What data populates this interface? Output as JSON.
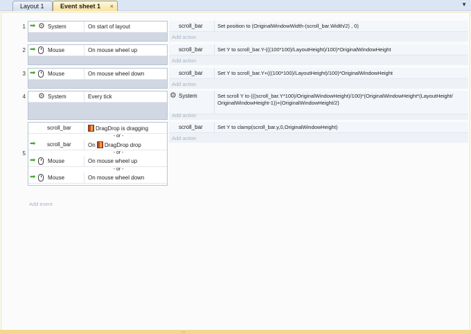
{
  "tabs": [
    {
      "label": "Layout 1"
    },
    {
      "label": "Event sheet 1",
      "close": "×",
      "active": true
    }
  ],
  "tab_menu_icon": "chevron-down-icon",
  "events": [
    {
      "number": "1",
      "conditions": [
        {
          "object": "System",
          "icon": "gear-icon",
          "text": "On start of layout"
        }
      ],
      "actions": [
        {
          "object": "scroll_bar",
          "text": "Set position to (OriginalWindowWidth-(scroll_bar.Width/2)  , 0)"
        }
      ],
      "add_action": "Add action"
    },
    {
      "number": "2",
      "conditions": [
        {
          "object": "Mouse",
          "icon": "mouse-icon",
          "text": "On mouse wheel up"
        }
      ],
      "actions": [
        {
          "object": "scroll_bar",
          "text": "Set Y to scroll_bar.Y-(((100*100)/LayoutHeight)/100)*OriginalWindowHeight"
        }
      ],
      "add_action": "Add action"
    },
    {
      "number": "3",
      "conditions": [
        {
          "object": "Mouse",
          "icon": "mouse-icon",
          "text": "On mouse wheel down"
        }
      ],
      "actions": [
        {
          "object": "scroll_bar",
          "text": "Set Y to scroll_bar.Y+(((100*100)/LayoutHeight)/100)*OriginalWindowHeight"
        }
      ],
      "add_action": "Add action"
    },
    {
      "number": "4",
      "conditions": [
        {
          "object": "System",
          "icon": "gear-icon",
          "text": "Every tick"
        }
      ],
      "actions": [
        {
          "object": "System",
          "icon": "gear-icon",
          "text_line1": "Set scroll Y to (((scroll_bar.Y*100)/OriginalWindowHeight)/100)*(OriginalWindowHeight*(LayoutHeight/",
          "text_line2": "OriginalWindowHeight-1))+(OriginalWindowHeight/2)"
        }
      ],
      "add_action": "Add action"
    },
    {
      "number": "5",
      "conditions": [
        {
          "object": "scroll_bar",
          "icon": "",
          "text": "DragDrop is dragging"
        },
        {
          "object": "scroll_bar",
          "icon": "",
          "text_prefix": "On",
          "text": "DragDrop drop"
        },
        {
          "object": "Mouse",
          "icon": "mouse-icon",
          "text": "On mouse wheel up"
        },
        {
          "object": "Mouse",
          "icon": "mouse-icon",
          "text": "On mouse wheel down"
        }
      ],
      "or_label": "- or -",
      "actions": [
        {
          "object": "scroll_bar",
          "text": "Set Y to clamp(scroll_bar.y,0,OriginalWindowHeight)"
        }
      ],
      "add_action": "Add action"
    }
  ],
  "add_event": "Add event",
  "colors": {
    "tab_active": "#f8e2a0",
    "condition_bg": "#ffffff",
    "action_bg": "#f3f6fa",
    "placeholder_text": "#a9b3c2",
    "arrow": "#4aa532"
  }
}
